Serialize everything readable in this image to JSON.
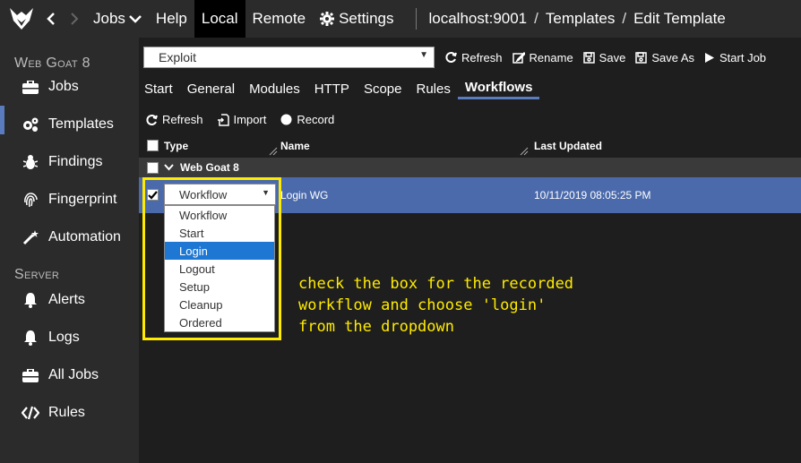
{
  "topbar": {
    "nav": [
      "Jobs",
      "Help",
      "Local",
      "Remote",
      "Settings"
    ],
    "active_nav": "Local",
    "breadcrumb": [
      "localhost:9001",
      "Templates",
      "Edit Template"
    ]
  },
  "sidebar": {
    "section1": "Web Goat 8",
    "items1": [
      "Jobs",
      "Templates",
      "Findings",
      "Fingerprint",
      "Automation"
    ],
    "section2": "Server",
    "items2": [
      "Alerts",
      "Logs",
      "All Jobs",
      "Rules"
    ]
  },
  "toolbar": {
    "select_value": "Exploit",
    "buttons": [
      "Refresh",
      "Rename",
      "Save",
      "Save As",
      "Start Job"
    ]
  },
  "tabs": [
    "Start",
    "General",
    "Modules",
    "HTTP",
    "Scope",
    "Rules",
    "Workflows"
  ],
  "subtoolbar": [
    "Refresh",
    "Import",
    "Record"
  ],
  "table": {
    "headers": [
      "Type",
      "Name",
      "Last Updated"
    ],
    "group": "Web Goat 8",
    "row": {
      "type": "Workflow",
      "name": "Login WG",
      "last_updated": "10/11/2019 08:05:25 PM"
    }
  },
  "dropdown": {
    "options": [
      "Workflow",
      "Start",
      "Login",
      "Logout",
      "Setup",
      "Cleanup",
      "Ordered"
    ],
    "highlighted": "Login"
  },
  "annotation": {
    "line1": "check the box for the recorded",
    "line2": "workflow and choose 'login'",
    "line3": "from the dropdown"
  },
  "colors": {
    "accent": "#5a7bbd",
    "annotation": "#ffeb00",
    "dropdown_highlight": "#1e77d3"
  }
}
